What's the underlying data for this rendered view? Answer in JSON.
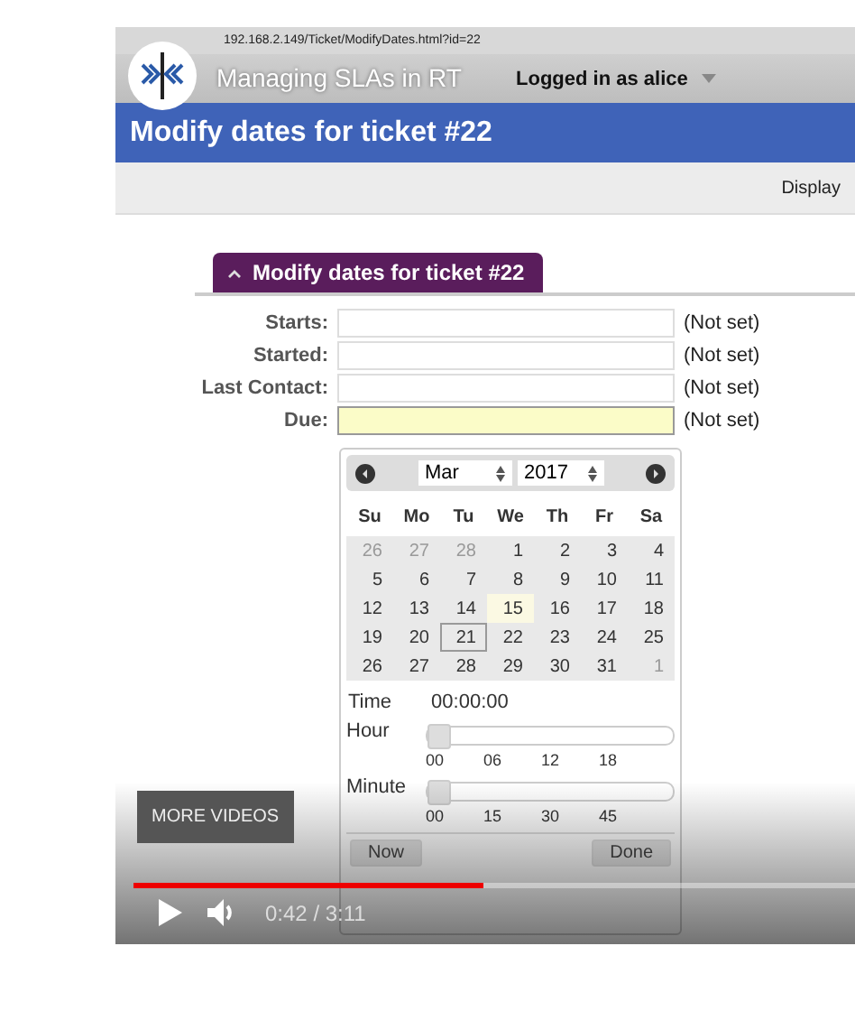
{
  "video": {
    "title": "Managing SLAs in RT",
    "more_videos": "MORE VIDEOS",
    "time": "0:42 / 3:11",
    "progress": {
      "level": 0.485
    }
  },
  "browser": {
    "url": "192.168.2.149/Ticket/ModifyDates.html?id=22"
  },
  "header": {
    "user_menu": "Logged in as alice"
  },
  "page_title": "Modify dates for ticket #22",
  "page_menu": [
    "Display"
  ],
  "section": {
    "title": "Modify dates for ticket #22",
    "expanded": true
  },
  "fields": [
    {
      "label": "Starts:",
      "note": "(Not set)",
      "focused": false
    },
    {
      "label": "Started:",
      "note": "(Not set)",
      "focused": false
    },
    {
      "label": "Last Contact:",
      "note": "(Not set)",
      "focused": false
    },
    {
      "label": "Due:",
      "note": "(Not set)",
      "focused": true
    }
  ],
  "datepicker": {
    "month": "Mar",
    "year": "2017",
    "weekdays": [
      "Su",
      "Mo",
      "Tu",
      "We",
      "Th",
      "Fr",
      "Sa"
    ],
    "weeks": [
      [
        {
          "day": "26",
          "other_month": true,
          "today": false,
          "hovered": false
        },
        {
          "day": "27",
          "other_month": true,
          "today": false,
          "hovered": false
        },
        {
          "day": "28",
          "other_month": true,
          "today": false,
          "hovered": false
        },
        {
          "day": "1",
          "other_month": false,
          "today": false,
          "hovered": false
        },
        {
          "day": "2",
          "other_month": false,
          "today": false,
          "hovered": false
        },
        {
          "day": "3",
          "other_month": false,
          "today": false,
          "hovered": false
        },
        {
          "day": "4",
          "other_month": false,
          "today": false,
          "hovered": false
        }
      ],
      [
        {
          "day": "5",
          "other_month": false,
          "today": false,
          "hovered": false
        },
        {
          "day": "6",
          "other_month": false,
          "today": false,
          "hovered": false
        },
        {
          "day": "7",
          "other_month": false,
          "today": false,
          "hovered": false
        },
        {
          "day": "8",
          "other_month": false,
          "today": false,
          "hovered": false
        },
        {
          "day": "9",
          "other_month": false,
          "today": false,
          "hovered": false
        },
        {
          "day": "10",
          "other_month": false,
          "today": false,
          "hovered": false
        },
        {
          "day": "11",
          "other_month": false,
          "today": false,
          "hovered": false
        }
      ],
      [
        {
          "day": "12",
          "other_month": false,
          "today": false,
          "hovered": false
        },
        {
          "day": "13",
          "other_month": false,
          "today": false,
          "hovered": false
        },
        {
          "day": "14",
          "other_month": false,
          "today": false,
          "hovered": false
        },
        {
          "day": "15",
          "other_month": false,
          "today": true,
          "hovered": false
        },
        {
          "day": "16",
          "other_month": false,
          "today": false,
          "hovered": false
        },
        {
          "day": "17",
          "other_month": false,
          "today": false,
          "hovered": false
        },
        {
          "day": "18",
          "other_month": false,
          "today": false,
          "hovered": false
        }
      ],
      [
        {
          "day": "19",
          "other_month": false,
          "today": false,
          "hovered": false
        },
        {
          "day": "20",
          "other_month": false,
          "today": false,
          "hovered": false
        },
        {
          "day": "21",
          "other_month": false,
          "today": false,
          "hovered": true
        },
        {
          "day": "22",
          "other_month": false,
          "today": false,
          "hovered": false
        },
        {
          "day": "23",
          "other_month": false,
          "today": false,
          "hovered": false
        },
        {
          "day": "24",
          "other_month": false,
          "today": false,
          "hovered": false
        },
        {
          "day": "25",
          "other_month": false,
          "today": false,
          "hovered": false
        }
      ],
      [
        {
          "day": "26",
          "other_month": false,
          "today": false,
          "hovered": false
        },
        {
          "day": "27",
          "other_month": false,
          "today": false,
          "hovered": false
        },
        {
          "day": "28",
          "other_month": false,
          "today": false,
          "hovered": false
        },
        {
          "day": "29",
          "other_month": false,
          "today": false,
          "hovered": false
        },
        {
          "day": "30",
          "other_month": false,
          "today": false,
          "hovered": false
        },
        {
          "day": "31",
          "other_month": false,
          "today": false,
          "hovered": false
        },
        {
          "day": "1",
          "other_month": true,
          "today": false,
          "hovered": false
        }
      ]
    ],
    "time_label": "Time",
    "time": "00:00:00",
    "sliders": [
      {
        "label": "Hour",
        "level": 0,
        "ticks": [
          "00",
          "06",
          "12",
          "18"
        ]
      },
      {
        "label": "Minute",
        "level": 0,
        "ticks": [
          "00",
          "15",
          "30",
          "45"
        ]
      }
    ],
    "buttons": [
      "Now",
      "Done"
    ]
  }
}
